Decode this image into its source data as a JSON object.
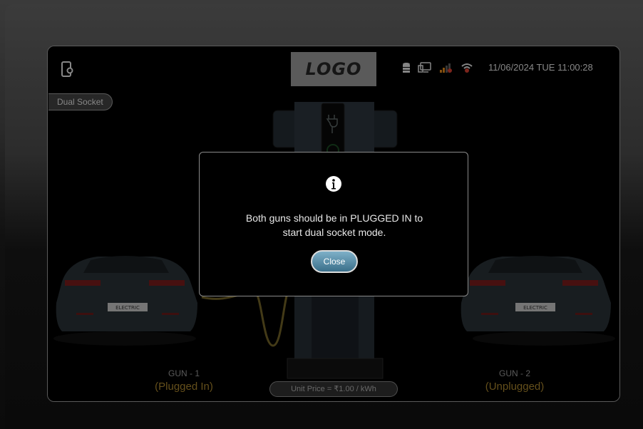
{
  "header": {
    "logo_text": "LOGO",
    "datetime": "11/06/2024 TUE 11:00:28",
    "status_icons": [
      "database-icon",
      "network-icon",
      "signal-bars-icon",
      "wifi-icon"
    ]
  },
  "mode_button": {
    "label": "Dual Socket"
  },
  "guns": [
    {
      "label": "GUN - 1",
      "status": "(Plugged In)"
    },
    {
      "label": "GUN - 2",
      "status": "(Unplugged)"
    }
  ],
  "cars": [
    {
      "plate": "ELECTRIC"
    },
    {
      "plate": "ELECTRIC"
    }
  ],
  "unit_price": "Unit Price = ₹1.00 / kWh",
  "dialog": {
    "message_line1": "Both guns should be in PLUGGED IN to",
    "message_line2": "start dual socket mode.",
    "close_label": "Close"
  },
  "colors": {
    "status_text": "#9a7a2a",
    "close_button": "#4f87a3",
    "cable": "#7a6a2a",
    "signal_warning": "#c0392b"
  }
}
